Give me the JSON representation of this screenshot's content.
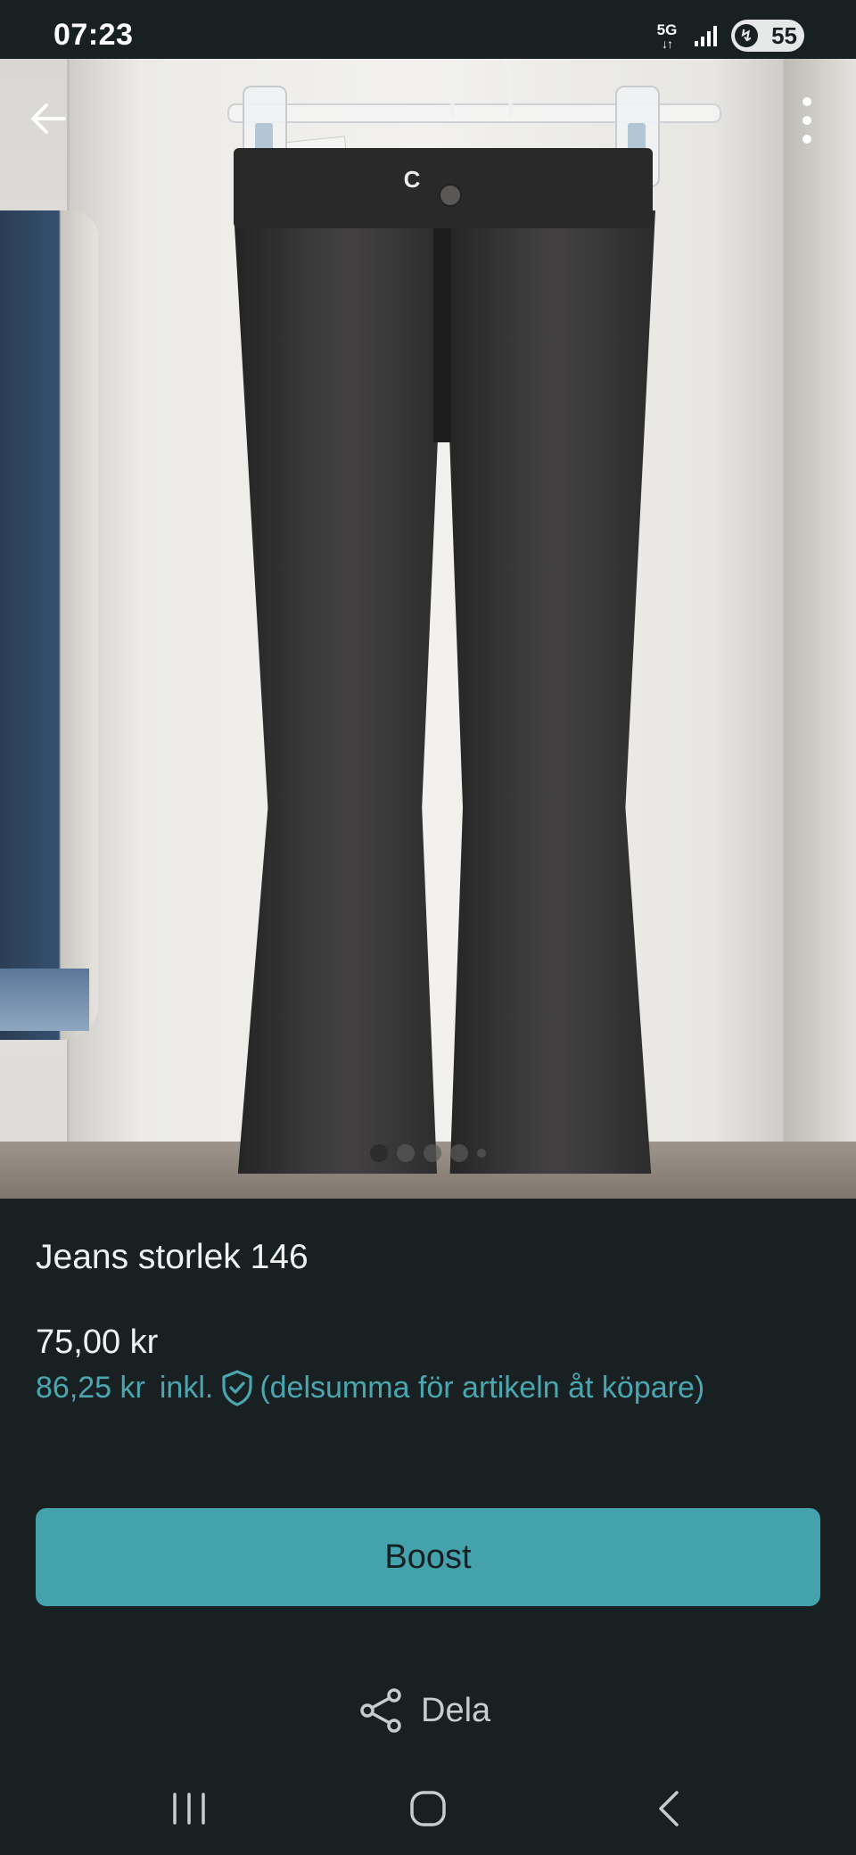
{
  "status_bar": {
    "time": "07:23",
    "network": "5G",
    "battery": "55"
  },
  "icons": {
    "back": "arrow-left-icon",
    "menu": "more-vertical-icon",
    "shield": "shield-check-icon",
    "share": "share-icon"
  },
  "gallery": {
    "dots": 5,
    "active_index": 0
  },
  "item": {
    "title": "Jeans storlek 146",
    "price": "75,00 kr",
    "price_incl_amount": "86,25 kr",
    "price_incl_label": "inkl.",
    "price_incl_note": "(delsumma för artikeln åt köpare)"
  },
  "actions": {
    "boost_label": "Boost",
    "share_label": "Dela"
  },
  "colors": {
    "background": "#192022",
    "accent": "#43a2ac",
    "accent_text": "#4aa6b0"
  }
}
